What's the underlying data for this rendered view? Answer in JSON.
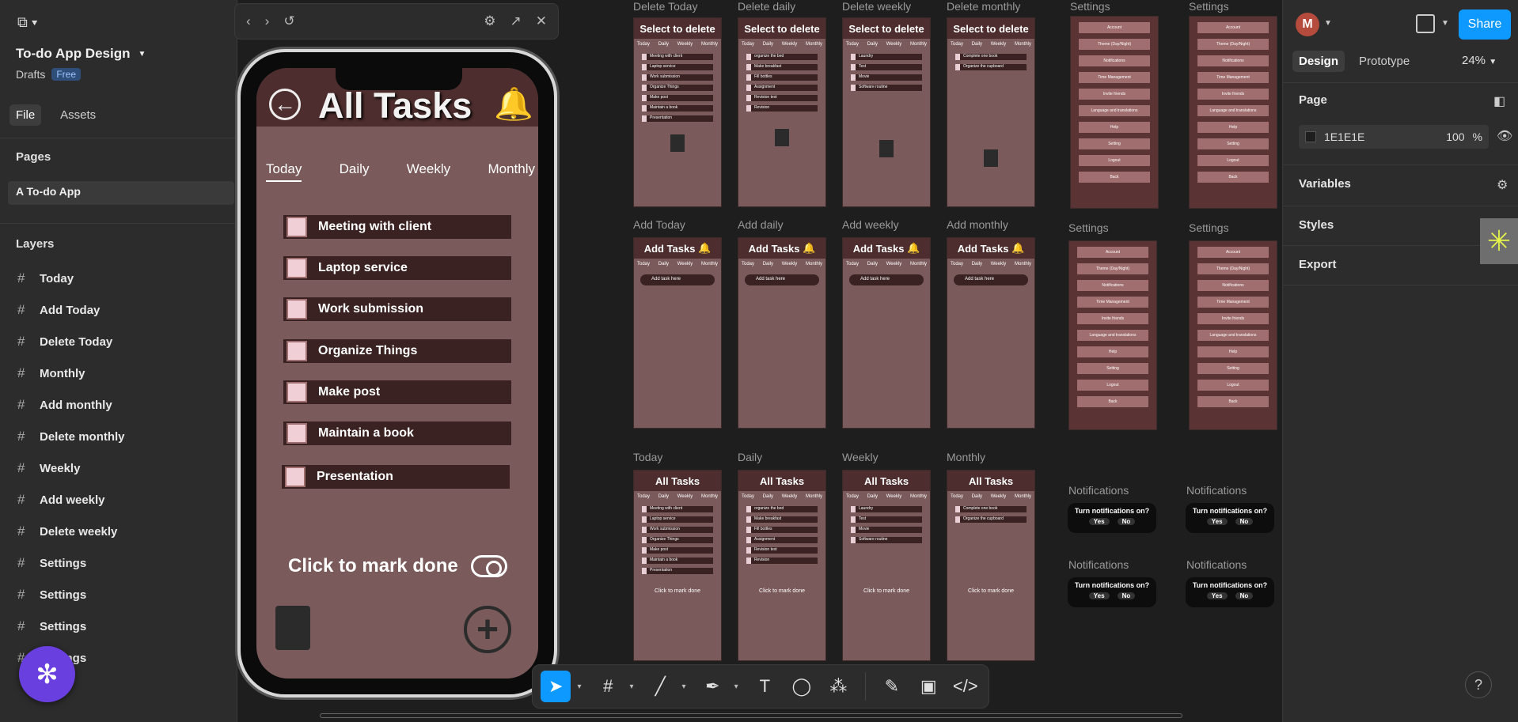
{
  "left": {
    "project_title": "To-do App Design",
    "drafts_label": "Drafts",
    "plan_badge": "Free",
    "tabs": [
      "File",
      "Assets"
    ],
    "pages_heading": "Pages",
    "current_page": "A To-do App",
    "layers_heading": "Layers",
    "layers": [
      "Today",
      "Add Today",
      "Delete Today",
      "Monthly",
      "Add monthly",
      "Delete monthly",
      "Weekly",
      "Add weekly",
      "Delete weekly",
      "Settings",
      "Settings",
      "Settings",
      "Settings"
    ]
  },
  "phone": {
    "title": "All Tasks",
    "tabs": [
      "Today",
      "Daily",
      "Weekly",
      "Monthly"
    ],
    "tasks": [
      "Meeting with client",
      "Laptop service",
      "Work submission",
      "Organize Things",
      "Make post",
      "Maintain a book",
      "Presentation"
    ],
    "mark_done": "Click to mark done"
  },
  "frames": {
    "delete_labels": [
      "Delete Today",
      "Delete daily",
      "Delete weekly",
      "Delete monthly"
    ],
    "delete_header": "Select to delete",
    "add_labels": [
      "Add Today",
      "Add daily",
      "Add weekly",
      "Add monthly"
    ],
    "add_header": "Add Tasks",
    "add_placeholder": "Add task here",
    "list_labels": [
      "Today",
      "Daily",
      "Weekly",
      "Monthly"
    ],
    "list_header": "All Tasks",
    "mini_tabs": [
      "Today",
      "Daily",
      "Weekly",
      "Monthly"
    ],
    "mini_mark_done": "Click to mark done",
    "today_tasks": [
      "Meeting with client",
      "Laptop service",
      "Work submission",
      "Organize Things",
      "Make post",
      "Maintain a book",
      "Presentation"
    ],
    "daily_tasks": [
      "organize the bed",
      "Make breakfast",
      "Fill bottles",
      "Assignment",
      "Revision text",
      "Revision"
    ],
    "weekly_tasks": [
      "Laundry",
      "Test",
      "Movie",
      "Software routine"
    ],
    "monthly_tasks": [
      "Complete one book",
      "Organize the cupboard"
    ],
    "settings_label": "Settings",
    "settings_items": [
      "Account",
      "Theme (Day/Night)",
      "Notifications",
      "Time Management",
      "Invite friends",
      "Language and translations",
      "Help",
      "Setting",
      "Logout",
      "Back"
    ],
    "notifications_label": "Notifications",
    "notif_question": "Turn notifications on?",
    "notif_yes": "Yes",
    "notif_no": "No"
  },
  "right": {
    "avatar_letter": "M",
    "share_label": "Share",
    "tabs": [
      "Design",
      "Prototype"
    ],
    "zoom": "24%",
    "page_heading": "Page",
    "page_color": "1E1E1E",
    "page_opacity": "100",
    "percent": "%",
    "variables": "Variables",
    "styles": "Styles",
    "export": "Export"
  },
  "colors": {
    "accent": "#0d99ff",
    "canvas": "#1e1e1e",
    "frame_bg": "#7a5a5a",
    "frame_header": "#4d2d2d"
  }
}
